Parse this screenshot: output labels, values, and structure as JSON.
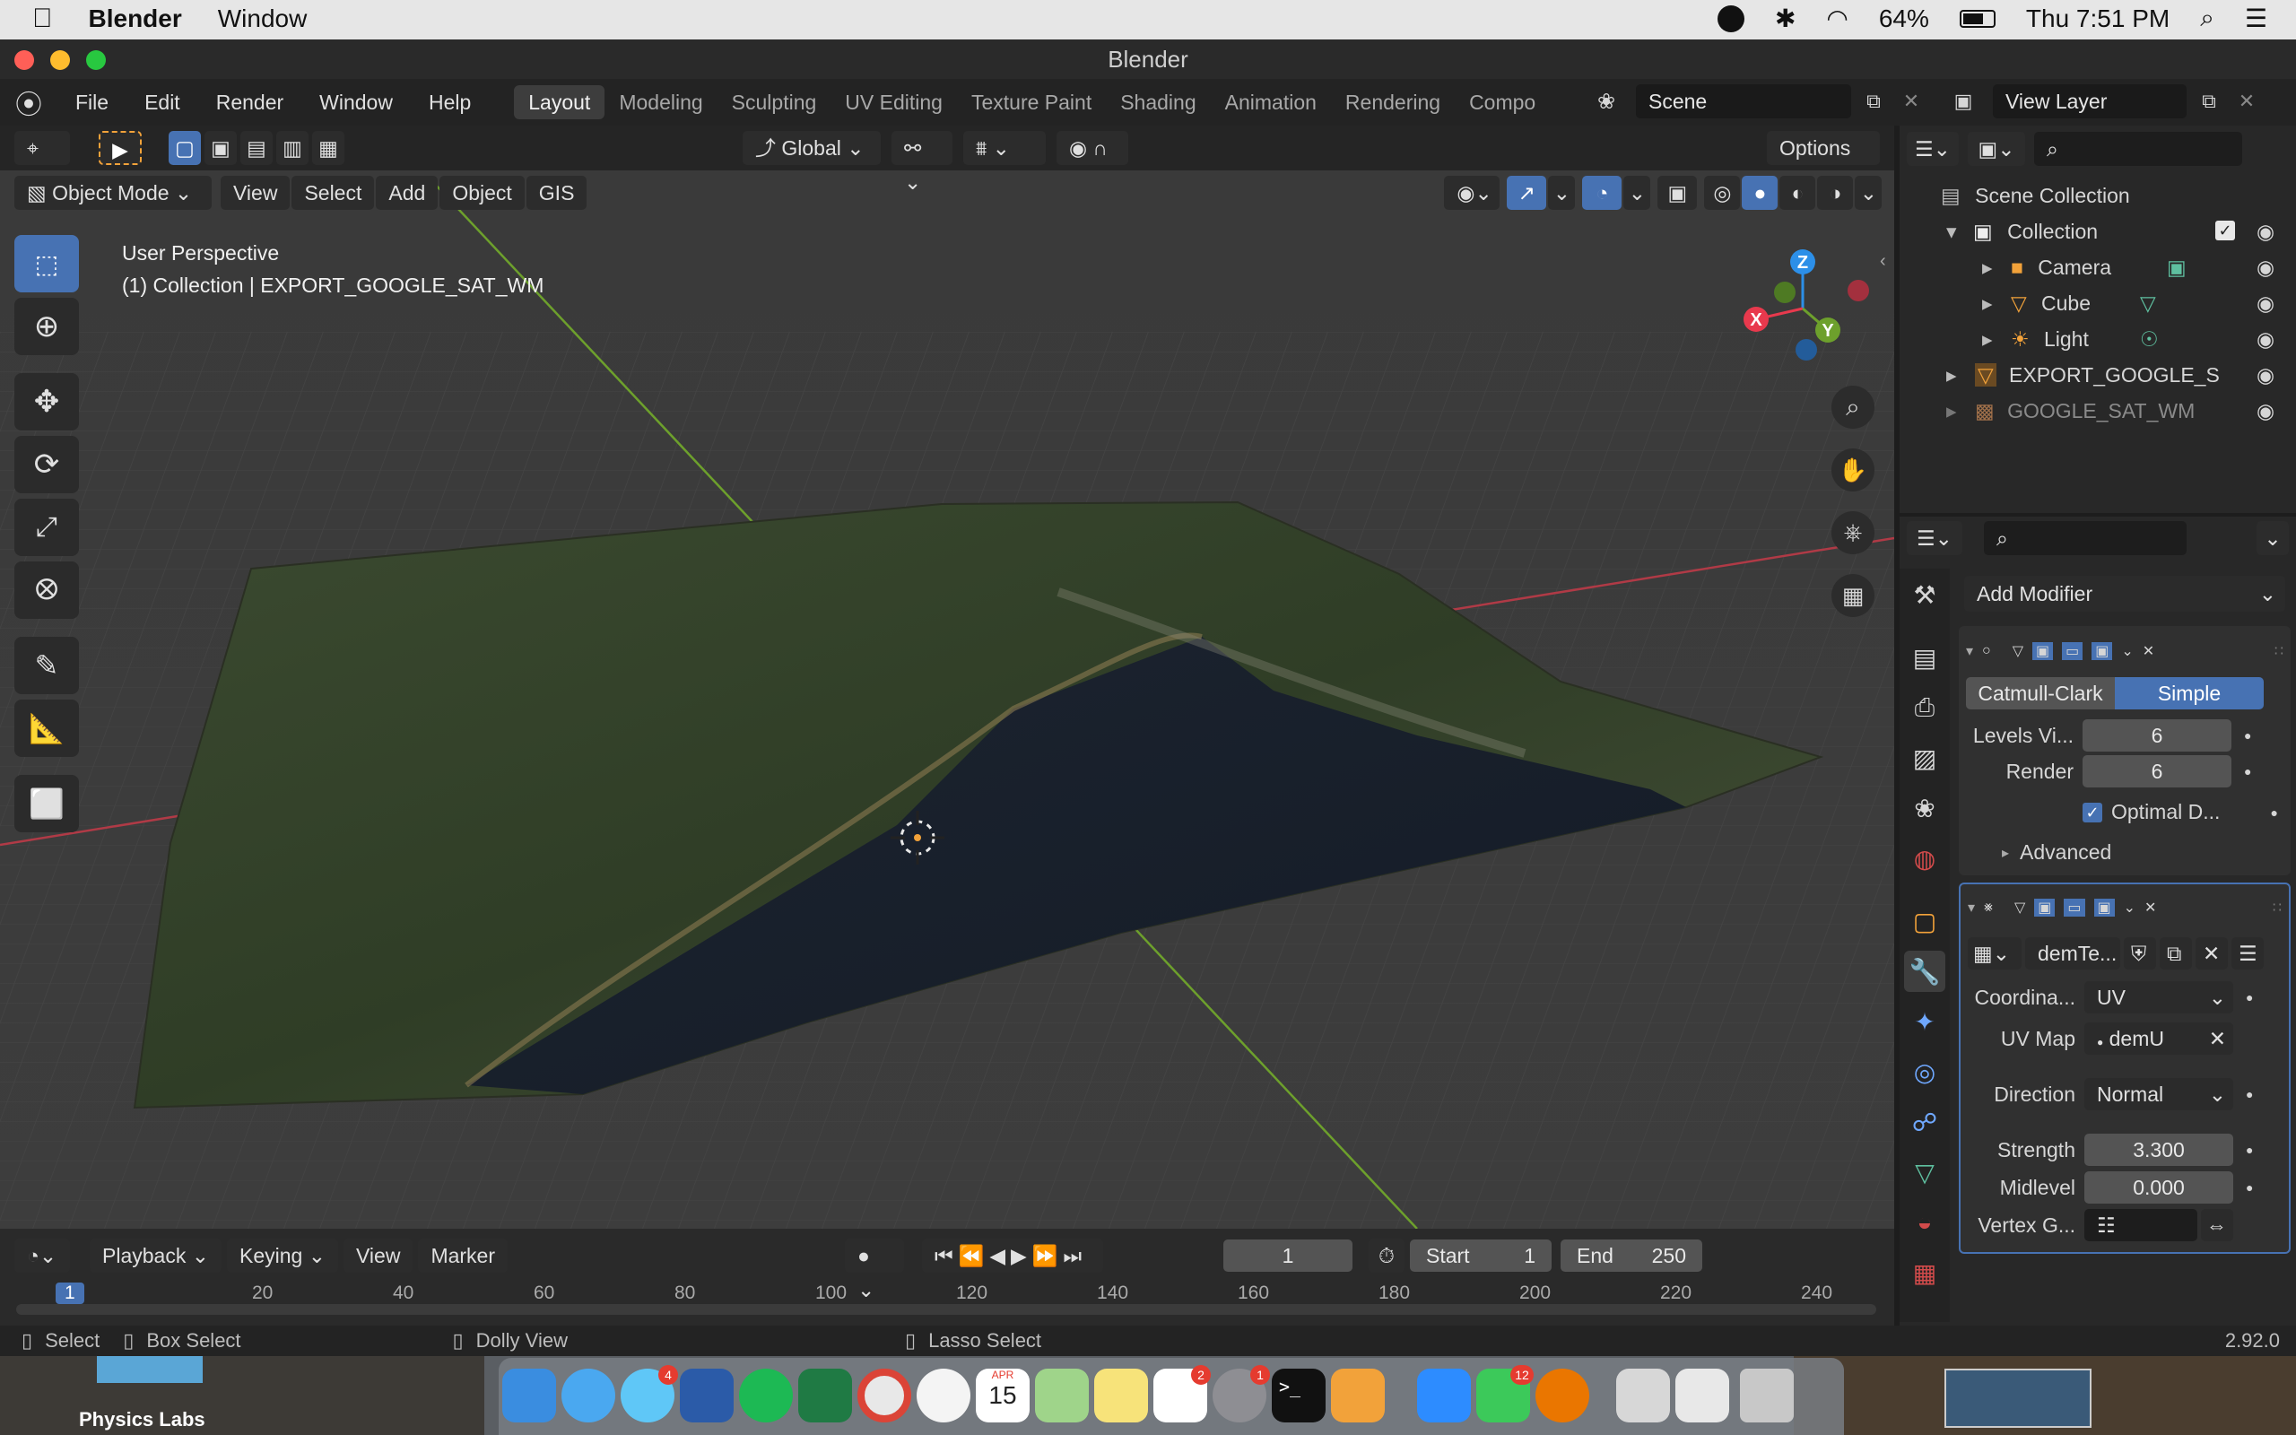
{
  "mac_menubar": {
    "app_name": "Blender",
    "menu": "Window",
    "battery": "64%",
    "clock": "Thu 7:51 PM"
  },
  "window_title": "Blender",
  "topbar": {
    "menus": [
      "File",
      "Edit",
      "Render",
      "Window",
      "Help"
    ],
    "workspaces": [
      "Layout",
      "Modeling",
      "Sculpting",
      "UV Editing",
      "Texture Paint",
      "Shading",
      "Animation",
      "Rendering",
      "Compo"
    ],
    "active_workspace": "Layout",
    "scene": "Scene",
    "view_layer": "View Layer"
  },
  "viewport": {
    "transform_orientation": "Global",
    "options_label": "Options",
    "mode": "Object Mode",
    "header_menus": [
      "View",
      "Select",
      "Add",
      "Object",
      "GIS"
    ],
    "overlay_line1": "User Perspective",
    "overlay_line2": "(1) Collection | EXPORT_GOOGLE_SAT_WM",
    "gizmo_axes": {
      "x": "X",
      "y": "Y",
      "z": "Z"
    }
  },
  "outliner": {
    "root": "Scene Collection",
    "collection": "Collection",
    "items": [
      {
        "name": "Camera",
        "icon": "camera-icon"
      },
      {
        "name": "Cube",
        "icon": "mesh-icon"
      },
      {
        "name": "Light",
        "icon": "light-icon"
      }
    ],
    "export_object": "EXPORT_GOOGLE_S",
    "google_object": "GOOGLE_SAT_WM"
  },
  "properties": {
    "add_modifier": "Add Modifier",
    "subsurf": {
      "tab_catmull": "Catmull-Clark",
      "tab_simple": "Simple",
      "levels_label": "Levels Vi...",
      "levels_value": "6",
      "render_label": "Render",
      "render_value": "6",
      "optimal_label": "Optimal D...",
      "advanced_label": "Advanced"
    },
    "displace": {
      "texture_name": "demTe...",
      "coord_label": "Coordina...",
      "coord_value": "UV",
      "uvmap_label": "UV Map",
      "uvmap_value": "demU",
      "direction_label": "Direction",
      "direction_value": "Normal",
      "strength_label": "Strength",
      "strength_value": "3.300",
      "midlevel_label": "Midlevel",
      "midlevel_value": "0.000",
      "vertex_label": "Vertex G..."
    }
  },
  "timeline": {
    "menus": [
      "Playback",
      "Keying",
      "View",
      "Marker"
    ],
    "current_frame": "1",
    "start_label": "Start",
    "start_value": "1",
    "end_label": "End",
    "end_value": "250",
    "ruler_ticks": [
      "1",
      "20",
      "40",
      "60",
      "80",
      "100",
      "120",
      "140",
      "160",
      "180",
      "200",
      "220",
      "240"
    ]
  },
  "statusbar": {
    "select": "Select",
    "box_select": "Box Select",
    "dolly_view": "Dolly View",
    "lasso_select": "Lasso Select",
    "version": "2.92.0"
  },
  "dock": {
    "desktop_label": "Physics Labs",
    "calendar_month": "APR",
    "calendar_day": "15",
    "badges": {
      "messages": "4",
      "reminders": "2",
      "settings": "1",
      "facetime": "12"
    }
  },
  "colors": {
    "accent_blue": "#4772b3",
    "axis_red": "#e8394d",
    "axis_green": "#6da02c",
    "axis_blue": "#2c8fe8"
  }
}
